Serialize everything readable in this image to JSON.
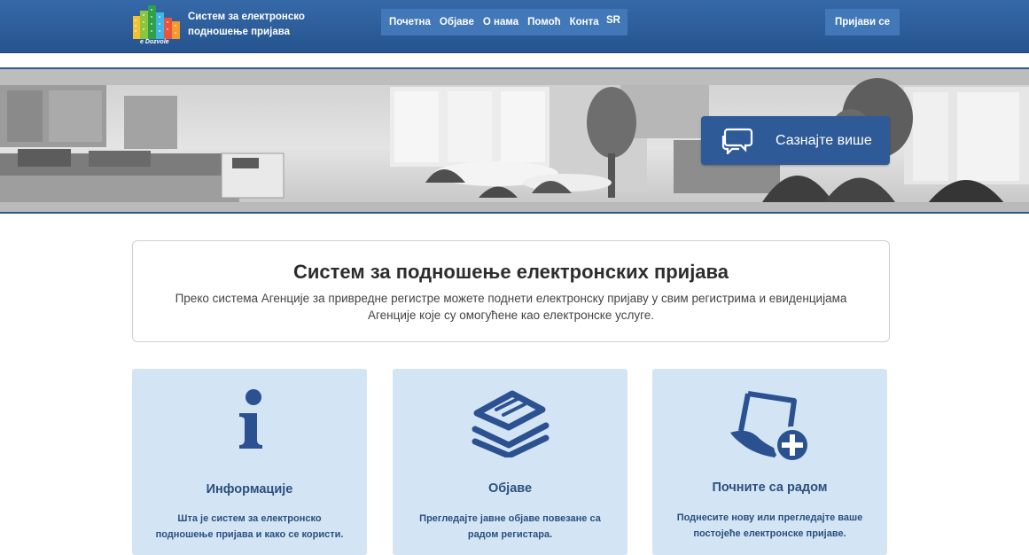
{
  "header": {
    "logo_caption": "e Dozvole",
    "site_title": "Систем за електронско подношење пријава",
    "nav": [
      "Почетна",
      "Објаве",
      "О нама",
      "Помоћ",
      "Контакт"
    ],
    "language": "SR",
    "login_label": "Пријави се"
  },
  "hero": {
    "learn_more_label": "Сазнајте више"
  },
  "intro": {
    "title": "Систем за подношење електронских пријава",
    "text": "Преко система Агенције за привредне регистре можете поднети електронску пријаву у свим регистрима и евиденцијама Агенције које су омогућене као електронске услуге."
  },
  "cards": [
    {
      "icon": "info-icon",
      "title": "Информације",
      "description": "Шта је систем за електронско подношење пријава и како се користи."
    },
    {
      "icon": "announcements-icon",
      "title": "Објаве",
      "description": "Прегледајте јавне објаве повезане са радом регистара."
    },
    {
      "icon": "new-application-icon",
      "title": "Почните са радом",
      "description": "Поднесите нову или прегледајте ваше постојеће електронске пријаве."
    }
  ],
  "colors": {
    "header_blue": "#2e5f9e",
    "nav_blue": "#4277b8",
    "card_bg": "#d3e5f5",
    "accent_text": "#2b4f7e"
  }
}
